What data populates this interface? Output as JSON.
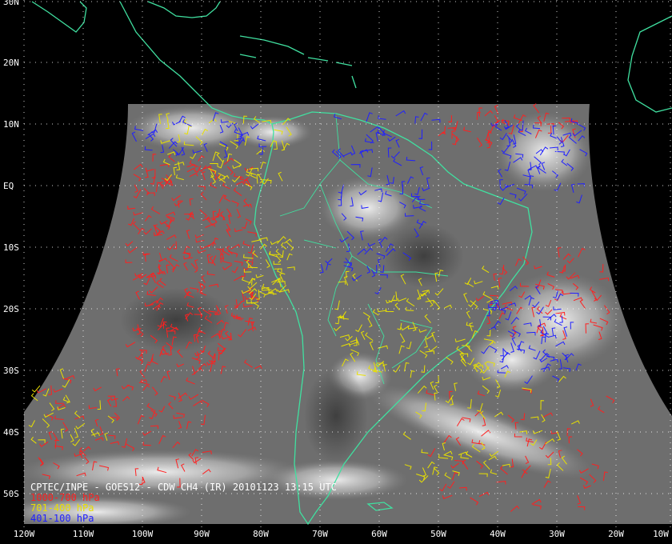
{
  "colors": {
    "background": "#000000",
    "coastline": "#40e0a0",
    "grid": "#ffffff",
    "low_level": "#ff2020",
    "mid_level": "#e8e000",
    "high_level": "#2020ff",
    "label": "#ffffff"
  },
  "map": {
    "projection": "geostationary",
    "lat_labels": [
      "30N",
      "20N",
      "10N",
      "EQ",
      "10S",
      "20S",
      "30S",
      "40S",
      "50S"
    ],
    "lon_labels": [
      "120W",
      "110W",
      "100W",
      "90W",
      "80W",
      "70W",
      "60W",
      "50W",
      "40W",
      "30W",
      "20W",
      "10W"
    ],
    "grid": "dotted"
  },
  "caption": {
    "title": "CPTEC/INPE - GOES12 - CDW CH4 (IR) 20101123 13:15 UTC",
    "legend": [
      {
        "label": "1000-700 hPa",
        "color": "#ff2020"
      },
      {
        "label": "701-400 hPa",
        "color": "#e8e000"
      },
      {
        "label": "401-100 hPa",
        "color": "#2020ff"
      }
    ]
  }
}
